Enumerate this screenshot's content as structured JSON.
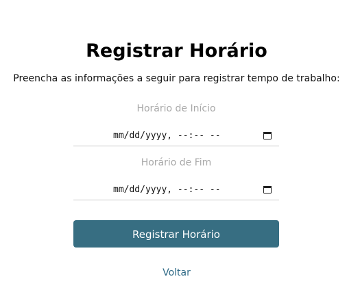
{
  "page": {
    "title": "Registrar Horário",
    "subtitle": "Preencha as informações a seguir para registrar tempo de trabalho:"
  },
  "form": {
    "start": {
      "label": "Horário de Início",
      "value": "mm/dd/yyyy, --:-- --",
      "icon": "calendar-icon"
    },
    "end": {
      "label": "Horário de Fim",
      "value": "mm/dd/yyyy, --:-- --",
      "icon": "calendar-icon"
    },
    "submit_label": "Registrar Horário",
    "back_label": "Voltar"
  },
  "colors": {
    "primary_button": "#376e82",
    "link": "#2f6a86",
    "label_gray": "#a8a8a8"
  }
}
